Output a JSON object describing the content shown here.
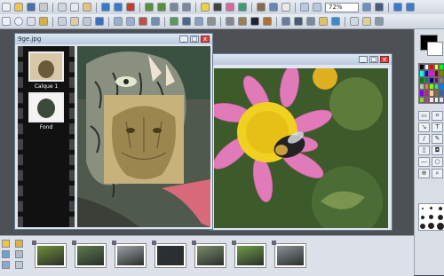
{
  "toolbar": {
    "zoom_value": "72%"
  },
  "windows": {
    "cat": {
      "title": "9ge.jpg",
      "min": "_",
      "max": "□",
      "close": "x"
    },
    "flower": {
      "title": "",
      "min": "_",
      "max": "□",
      "close": "x"
    }
  },
  "filmstrip": {
    "layers": [
      {
        "label": "Calque 1"
      },
      {
        "label": "Fond"
      }
    ]
  },
  "colors": {
    "palette": [
      "#000000",
      "#ffffff",
      "#ff0000",
      "#ffff00",
      "#00ff00",
      "#00ffff",
      "#0000ff",
      "#ff00ff",
      "#800000",
      "#808000",
      "#008000",
      "#008080",
      "#000080",
      "#800080",
      "#808080",
      "#c0c0c0",
      "#ff8000",
      "#80ff00",
      "#00ff80",
      "#0080ff",
      "#8000ff",
      "#ff0080",
      "#ffcc99",
      "#996633",
      "#336699",
      "#99cc33",
      "#cc3399",
      "#ffe0e0",
      "#e0ffe0",
      "#e0e0ff"
    ],
    "foreground": "#000000",
    "background": "#ffffff"
  },
  "thumbnails": [
    {
      "name": "thumb-1",
      "color": "#6f8f3a"
    },
    {
      "name": "thumb-2",
      "color": "#5d7a4c"
    },
    {
      "name": "thumb-3",
      "color": "#9aa0a6"
    },
    {
      "name": "thumb-4",
      "color": "#2b2f3a"
    },
    {
      "name": "thumb-5",
      "color": "#7a8a6a"
    },
    {
      "name": "thumb-6",
      "color": "#6f9a4a"
    },
    {
      "name": "thumb-7",
      "color": "#8a9098"
    }
  ]
}
